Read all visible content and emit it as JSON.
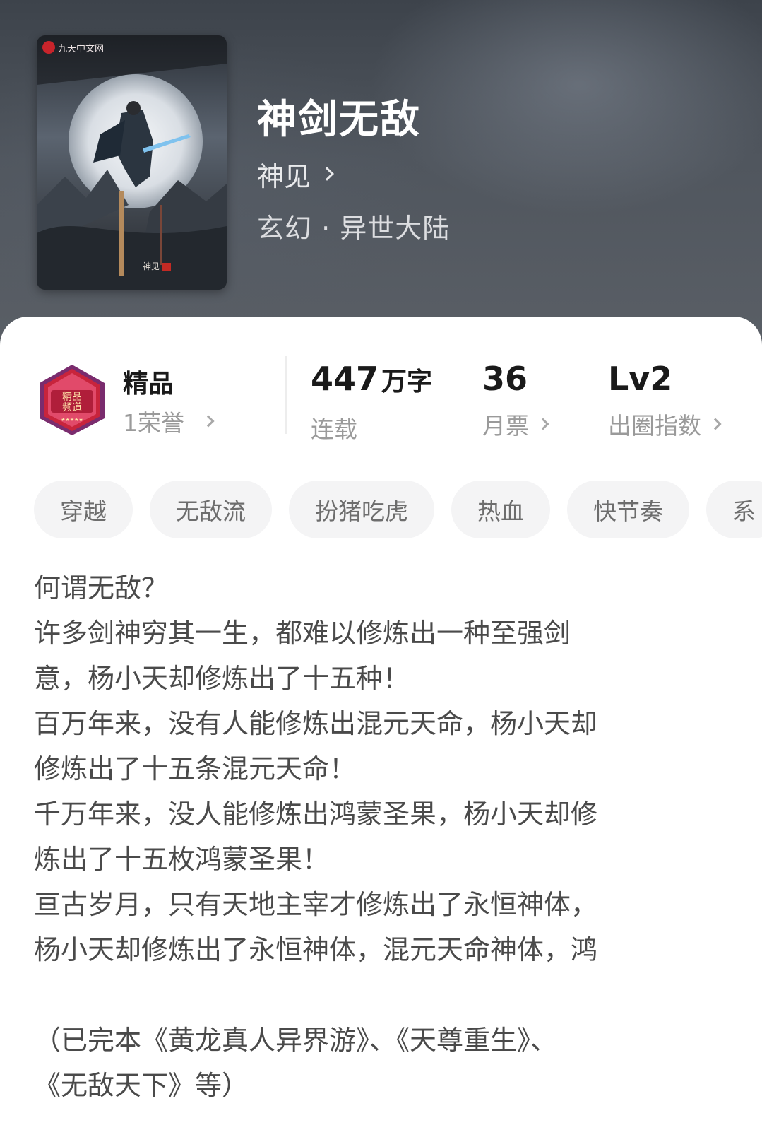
{
  "book": {
    "cover_brand": "九天中文网",
    "cover_author": "神见",
    "title": "神剑无敌",
    "author": "神见",
    "genre": "玄幻 · 异世大陆"
  },
  "stats": {
    "premium_title": "精品",
    "honor": "1荣誉",
    "word_count": "447",
    "word_unit": "万字",
    "word_status": "连载",
    "monthly_tickets": "36",
    "monthly_tickets_label": "月票",
    "level": "Lv2",
    "level_label": "出圈指数"
  },
  "tags": [
    "穿越",
    "无敌流",
    "扮猪吃虎",
    "热血",
    "快节奏",
    "系"
  ],
  "synopsis": {
    "lines": [
      "何谓无敌？",
      "许多剑神穷其一生，都难以修炼出一种至强剑",
      "意，杨小天却修炼出了十五种！",
      "百万年来，没有人能修炼出混元天命，杨小天却",
      "修炼出了十五条混元天命！",
      "千万年来，没人能修炼出鸿蒙圣果，杨小天却修",
      "炼出了十五枚鸿蒙圣果！",
      "亘古岁月，只有天地主宰才修炼出了永恒神体，",
      "杨小天却修炼出了永恒神体，混元天命神体，鸿"
    ],
    "footer_lines": [
      " （已完本《黄龙真人异界游》、《天尊重生》、",
      "《无敌天下》等）"
    ]
  },
  "colors": {
    "header_bg": "#4a5058",
    "tag_bg": "#f4f4f5",
    "badge_red": "#c8243c"
  }
}
